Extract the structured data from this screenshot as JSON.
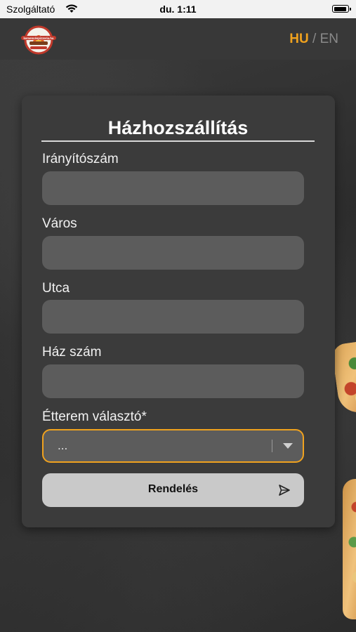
{
  "status_bar": {
    "carrier": "Szolgáltató",
    "time": "du. 1:11"
  },
  "header": {
    "logo_text": "kemencéspizzeria.hu",
    "lang_active": "HU",
    "lang_separator": "/",
    "lang_other": "EN"
  },
  "form": {
    "title": "Házhozszállítás",
    "fields": [
      {
        "label": "Irányítószám",
        "value": "",
        "placeholder": ""
      },
      {
        "label": "Város",
        "value": "",
        "placeholder": ""
      },
      {
        "label": "Utca",
        "value": "",
        "placeholder": ""
      },
      {
        "label": "Ház szám",
        "value": "",
        "placeholder": ""
      }
    ],
    "restaurant_select": {
      "label": "Étterem választó*",
      "value": "..."
    },
    "submit_label": "Rendelés"
  },
  "colors": {
    "accent": "#f0a21e",
    "card": "#3b3b3b",
    "field": "#5c5c5c",
    "button": "#c9c9c9"
  },
  "icons": [
    "wifi-icon",
    "battery-icon",
    "logo-icon",
    "chevron-down-icon",
    "send-icon"
  ]
}
